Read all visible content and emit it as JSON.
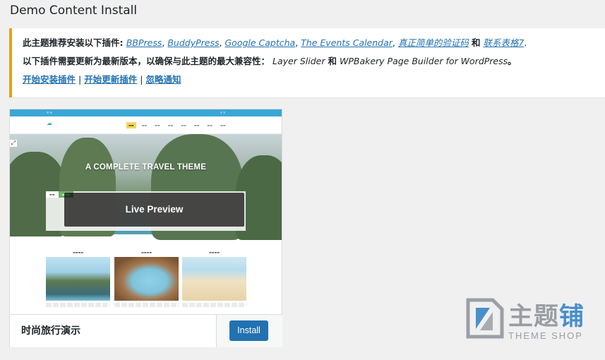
{
  "page": {
    "title": "Demo Content Install"
  },
  "notice": {
    "line1_prefix": "此主题推荐安装以下插件: ",
    "recommended_plugins": [
      "BBPress",
      "BuddyPress",
      "Google Captcha",
      "The Events Calendar",
      "真正简单的验证码"
    ],
    "and_word": "和",
    "last_plugin": "联系表格7",
    "line1_suffix": ".",
    "line2_prefix": "以下插件需要更新为最新版本，以确保与此主题的最大兼容性：",
    "update_plugin_1": "Layer Slider",
    "update_plugin_2": "WPBakery Page Builder for WordPress",
    "line2_suffix": "。",
    "begin_install_link": "开始安装插件",
    "begin_update_link": "开始更新插件",
    "dismiss_link": "忽略通知",
    "separator": "|",
    "accent_color": "#dba617",
    "link_color": "#2271b1"
  },
  "theme_card": {
    "preview": {
      "hero_title": "A COMPLETE TRAVEL THEME",
      "overlay_label": "Live Preview",
      "expand_icon": "expand-icon"
    },
    "theme_name": "时尚旅行演示",
    "install_label": "Install",
    "button_color": "#2271b1"
  },
  "watermark": {
    "brand_main": "主题",
    "brand_accent": "铺",
    "brand_sub": "THEME SHOP"
  }
}
